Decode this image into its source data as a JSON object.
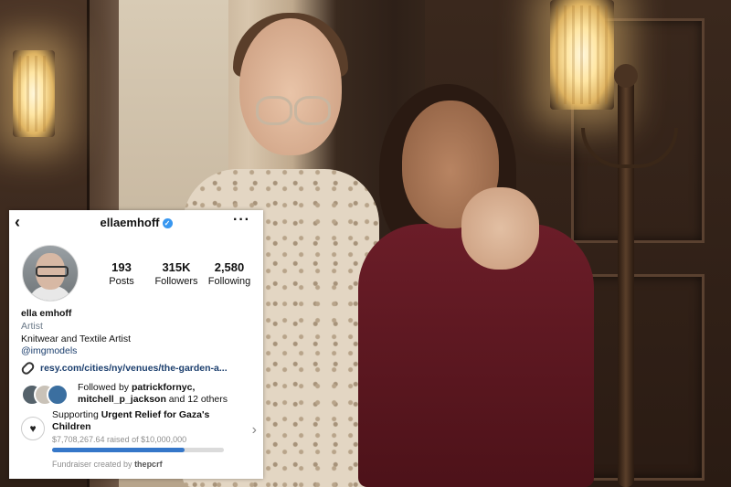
{
  "profile": {
    "username": "ellaemhoff",
    "stats": [
      {
        "value": "193",
        "label": "Posts"
      },
      {
        "value": "315K",
        "label": "Followers"
      },
      {
        "value": "2,580",
        "label": "Following"
      }
    ],
    "name": "ella emhoff",
    "category": "Artist",
    "bio": "Knitwear and Textile Artist",
    "tag": "@imgmodels",
    "link": "resy.com/cities/ny/venues/the-garden-a..."
  },
  "followed_by": {
    "prefix": "Followed by",
    "user1": "patrickfornyc,",
    "user2": "mitchell_p_jackson",
    "suffix": "and 12 others"
  },
  "fundraiser": {
    "prefix": "Supporting",
    "title": "Urgent Relief for Gaza's Children",
    "raised": "$7,708,267.64 raised of $10,000,000",
    "progress_fraction": 0.77,
    "creator_prefix": "Fundraiser created by",
    "creator": "thepcrf"
  },
  "icons": {
    "back": "chevron-left-icon",
    "verified": "verified-badge-icon",
    "more": "more-horizontal-icon",
    "link": "link-icon",
    "fundraiser": "heart-circle-icon",
    "chevron": "chevron-right-icon"
  },
  "colors": {
    "verified": "#3897f0",
    "link": "#1c3f6e",
    "progress": "#3577c9"
  }
}
